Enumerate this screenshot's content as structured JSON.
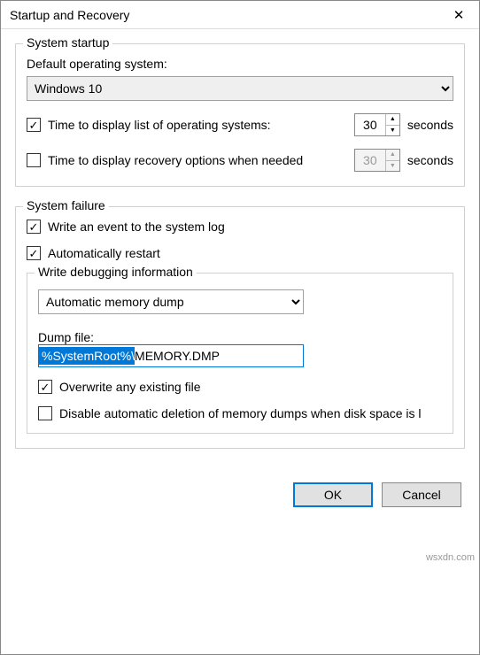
{
  "window": {
    "title": "Startup and Recovery"
  },
  "startup": {
    "group_title": "System startup",
    "default_os_label": "Default operating system:",
    "default_os_value": "Windows 10",
    "display_list_checked": true,
    "display_list_label": "Time to display list of operating systems:",
    "display_list_seconds": "30",
    "display_recovery_checked": false,
    "display_recovery_label": "Time to display recovery options when needed",
    "display_recovery_seconds": "30",
    "seconds_suffix": "seconds"
  },
  "failure": {
    "group_title": "System failure",
    "write_event_checked": true,
    "write_event_label": "Write an event to the system log",
    "auto_restart_checked": true,
    "auto_restart_label": "Automatically restart",
    "debug_group_title": "Write debugging information",
    "debug_type_value": "Automatic memory dump",
    "dump_file_label": "Dump file:",
    "dump_file_selected": "%SystemRoot%\\",
    "dump_file_rest": "MEMORY.DMP",
    "overwrite_checked": true,
    "overwrite_label": "Overwrite any existing file",
    "disable_delete_checked": false,
    "disable_delete_label": "Disable automatic deletion of memory dumps when disk space is l"
  },
  "buttons": {
    "ok": "OK",
    "cancel": "Cancel"
  },
  "watermark": "wsxdn.com"
}
